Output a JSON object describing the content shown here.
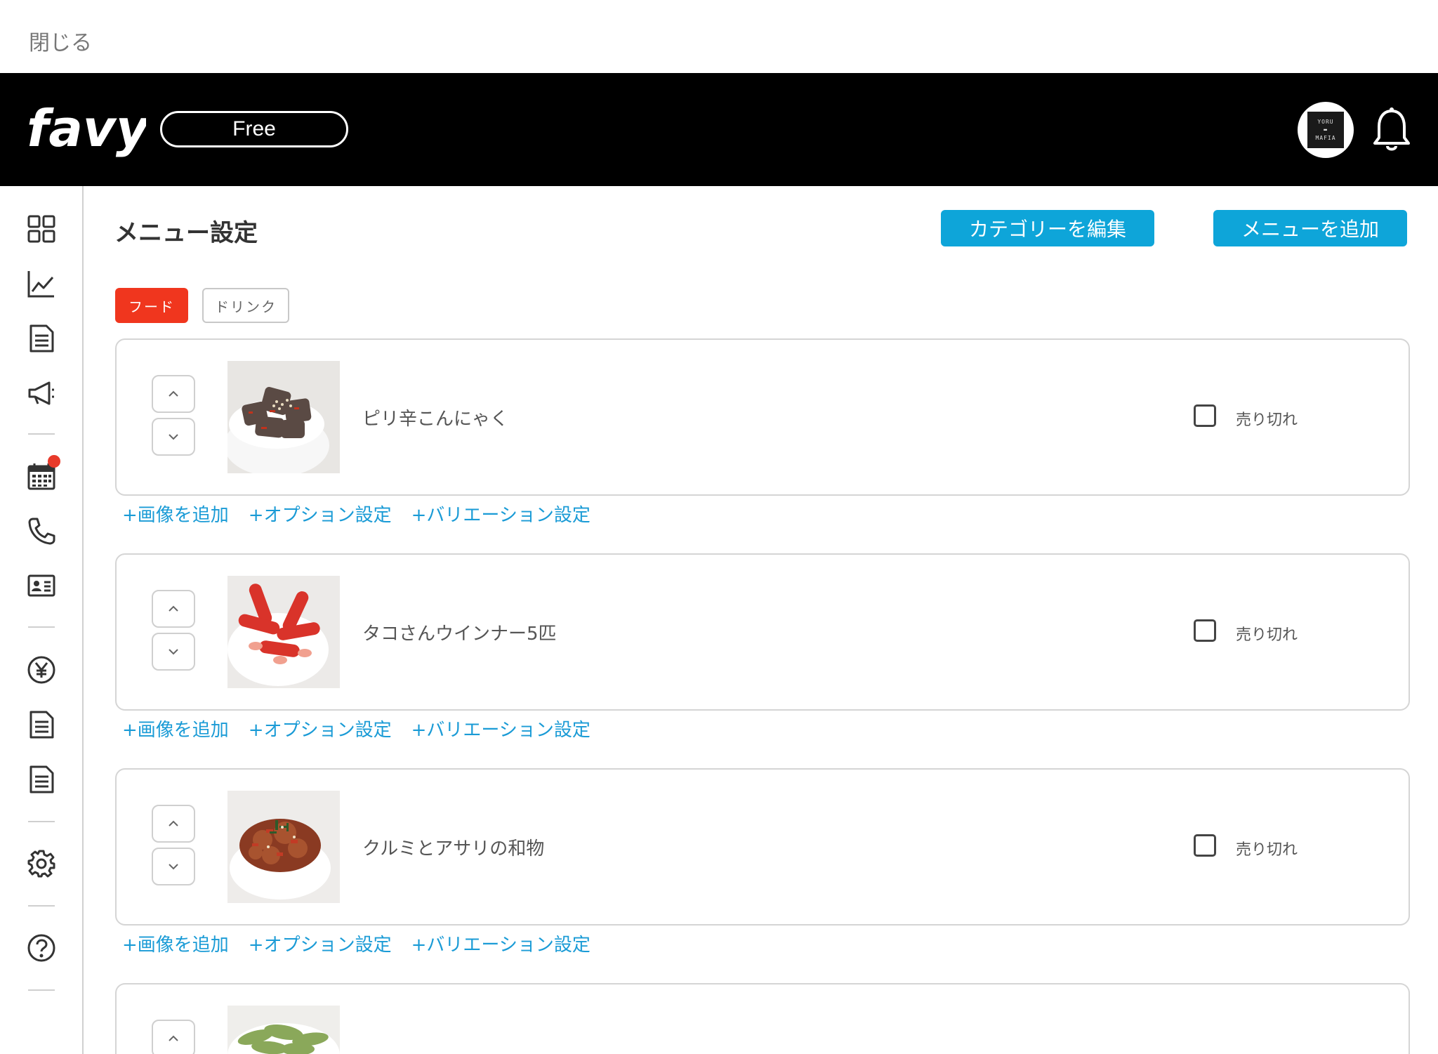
{
  "topbar": {
    "close_label": "閉じる"
  },
  "header": {
    "logo_text": "favy",
    "plan": "Free",
    "avatar_text_top": "YORU",
    "avatar_text_bottom": "MAFIA"
  },
  "page": {
    "title": "メニュー設定",
    "edit_category_label": "カテゴリーを編集",
    "add_menu_label": "メニューを追加"
  },
  "tabs": [
    {
      "label": "フード",
      "active": true
    },
    {
      "label": "ドリンク",
      "active": false
    }
  ],
  "common": {
    "soldout_label": "売り切れ",
    "add_image_label": "+画像を追加",
    "option_label": "+オプション設定",
    "variation_label": "+バリエーション設定"
  },
  "items": [
    {
      "name": "ピリ辛こんにゃく"
    },
    {
      "name": "タコさんウインナー5匹"
    },
    {
      "name": "クルミとアサリの和物"
    },
    {
      "name": ""
    }
  ],
  "colors": {
    "accent_blue": "#0ea5d9",
    "tab_active": "#f0361e",
    "link_blue": "#1a9bd6",
    "header_bg": "#000000",
    "notification": "#e83a2a"
  }
}
